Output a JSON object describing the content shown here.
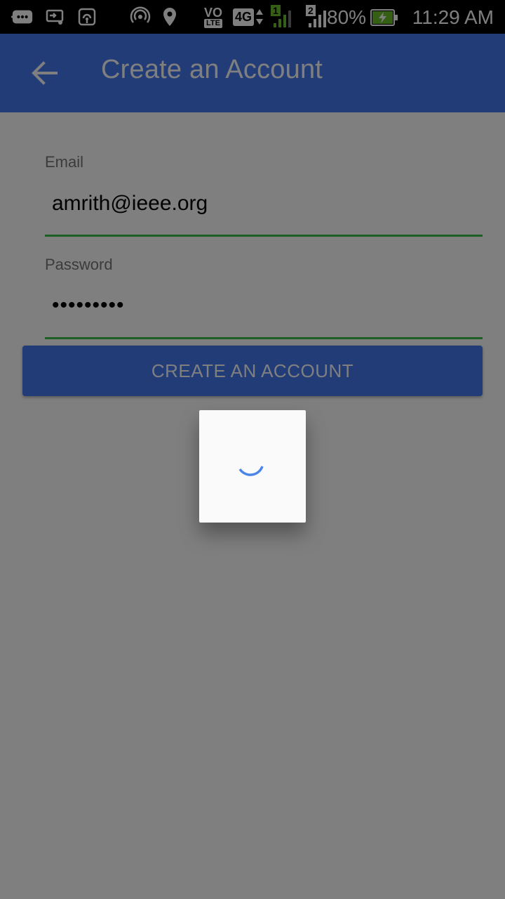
{
  "status_bar": {
    "battery_percent": "80%",
    "time": "11:29 AM",
    "network_badge": "4G",
    "volte_top": "VO",
    "volte_bottom": "LTE",
    "sim1": "1",
    "sim2": "2",
    "icons": [
      "chat-icon",
      "cast-icon",
      "hotspot-icon",
      "wifi-calling-icon",
      "location-icon",
      "volte-icon",
      "4g-icon",
      "signal-sim1-icon",
      "signal-sim2-icon",
      "battery-charging-icon"
    ]
  },
  "appbar": {
    "title": "Create an Account",
    "back_icon": "back-arrow-icon"
  },
  "form": {
    "email": {
      "label": "Email",
      "value": "amrith@ieee.org"
    },
    "password": {
      "label": "Password",
      "value": "•••••••••"
    },
    "submit_label": "CREATE AN ACCOUNT"
  },
  "dialog": {
    "spinner_icon": "loading-spinner-icon"
  },
  "colors": {
    "primary": "#4479f0",
    "accent_line": "#3fbf4b",
    "spinner": "#4a86e8",
    "status_bar": "#000000"
  }
}
